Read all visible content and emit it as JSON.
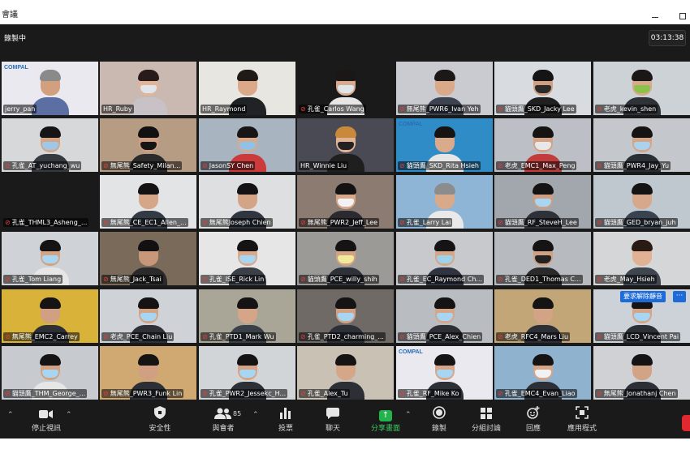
{
  "window": {
    "title": "會議"
  },
  "meeting": {
    "recording_label": "錄製中",
    "timer": "03:13:38"
  },
  "colors": {
    "active_speaker_border": "#c7e33b",
    "muted_mic": "#e0403f",
    "share_green": "#23b24c",
    "unmute_blue": "#1d6bd8"
  },
  "participants": [
    {
      "name": "jerry_pan",
      "muted": false,
      "bg": "#e9e9ef",
      "skin": "#d2a07f",
      "hair": "#8a8a8a",
      "shirt": "#5b6fa3",
      "mask": "",
      "logo": "COMPAL"
    },
    {
      "name": "HR_Ruby",
      "muted": false,
      "bg": "#c9b9b1",
      "skin": "#e2b49a",
      "hair": "#2a1b1b",
      "shirt": "#c8c2c6",
      "mask": "#dfe5ea",
      "active": true
    },
    {
      "name": "HR_Raymond",
      "muted": false,
      "bg": "#e8e6e1",
      "skin": "#dba98a",
      "hair": "#1f1a17",
      "shirt": "#202326",
      "mask": ""
    },
    {
      "name": "孔雀_Carlos Wang",
      "muted": true,
      "bg": "#1a1a1a",
      "skin": "#d8ab8f",
      "hair": "#1b1717",
      "shirt": "#e6e6e6",
      "mask": "#dde4ea"
    },
    {
      "name": "無尾熊_PWR6_Ivan Yeh",
      "muted": true,
      "bg": "#c9cbd0",
      "skin": "#d9a98a",
      "hair": "#1c1818",
      "shirt": "#3d4350",
      "mask": ""
    },
    {
      "name": "貓頭鷹_SKD_Jacky Lee",
      "muted": true,
      "bg": "#d8dbe0",
      "skin": "#cf9f82",
      "hair": "#151313",
      "shirt": "#202020",
      "mask": "#2b2b2b"
    },
    {
      "name": "老虎_kevin_shen",
      "muted": true,
      "bg": "#cdd2d6",
      "skin": "#d8a98b",
      "hair": "#1b1717",
      "shirt": "#2f3338",
      "mask": "#8bc34a"
    },
    {
      "name": "孔雀_AT_yuchang_wu",
      "muted": true,
      "bg": "#d7d8da",
      "skin": "#d5a587",
      "hair": "#161414",
      "shirt": "#353a40",
      "mask": "#9ec7e8"
    },
    {
      "name": "無尾熊_Safety_Milan...",
      "muted": true,
      "bg": "#b59c83",
      "skin": "#cf9d80",
      "hair": "#121010",
      "shirt": "#2b2b2b",
      "mask": "#151515"
    },
    {
      "name": "JasonSY Chen",
      "muted": true,
      "bg": "#a8b5c0",
      "skin": "#d8a98b",
      "hair": "#171515",
      "shirt": "#cc3b3b",
      "mask": "#8fc2e6"
    },
    {
      "name": "HR_Winnie Liu",
      "muted": false,
      "bg": "#4a4a55",
      "skin": "#e1b394",
      "hair": "#c88a3a",
      "shirt": "#1f1f1f",
      "mask": "#222222"
    },
    {
      "name": "貓頭鷹_SKD_Rita Hsieh",
      "muted": true,
      "bg": "#2f8cc6",
      "skin": "#d9aa8c",
      "hair": "#171414",
      "shirt": "#e6e6e6",
      "mask": "",
      "logo": "COMPAL"
    },
    {
      "name": "老虎_EMC1_Max_Peng",
      "muted": true,
      "bg": "#bcbfc5",
      "skin": "#d4a385",
      "hair": "#161313",
      "shirt": "#c23c3c",
      "mask": "#e8e8ea"
    },
    {
      "name": "貓頭鷹_PWR4_Jay_Yu",
      "muted": true,
      "bg": "#c4c7cc",
      "skin": "#d5a586",
      "hair": "#161313",
      "shirt": "#2a2f36",
      "mask": "#a9d2ef"
    },
    {
      "name": "孔雀_THML3_Asheng_...",
      "muted": true,
      "bg": "#1a1a1a",
      "skin": "",
      "hair": "",
      "shirt": "",
      "mask": "",
      "empty": true
    },
    {
      "name": "無尾熊_CE_EC1_Allen_...",
      "muted": true,
      "bg": "#e2e4e6",
      "skin": "#d6a688",
      "hair": "#141212",
      "shirt": "#343a44",
      "mask": ""
    },
    {
      "name": "無尾熊Joseph Chien",
      "muted": true,
      "bg": "#dedfe1",
      "skin": "#d4a486",
      "hair": "#141212",
      "shirt": "#303540",
      "mask": ""
    },
    {
      "name": "無尾熊_PWR2_Jeff_Lee",
      "muted": true,
      "bg": "#8b7b71",
      "skin": "#d7a789",
      "hair": "#141212",
      "shirt": "#2a2a30",
      "mask": "#f2f2f4"
    },
    {
      "name": "孔雀_Larry Lai",
      "muted": true,
      "bg": "#8fb5d6",
      "skin": "#d8a98b",
      "hair": "#8c8c8c",
      "shirt": "#e9e9e9",
      "mask": ""
    },
    {
      "name": "貓頭鷹_RF_SteveH_Lee",
      "muted": true,
      "bg": "#a2a7ad",
      "skin": "#cf9e80",
      "hair": "#151313",
      "shirt": "#2e3238",
      "mask": "#a7d5f2"
    },
    {
      "name": "貓頭鷹_GED_bryan_juh",
      "muted": true,
      "bg": "#bfc7cf",
      "skin": "#d7a88a",
      "hair": "#151313",
      "shirt": "#394350",
      "mask": ""
    },
    {
      "name": "孔雀_Tom Liang",
      "muted": true,
      "bg": "#cfd3d7",
      "skin": "#d3a385",
      "hair": "#151313",
      "shirt": "#e6e6e6",
      "mask": "#a7d5f2"
    },
    {
      "name": "無尾熊_Jack_Tsai",
      "muted": true,
      "bg": "#7a6a5a",
      "skin": "#c8977a",
      "hair": "#121010",
      "shirt": "#2a2a2a",
      "mask": ""
    },
    {
      "name": "孔雀_ISE_Rick Lin",
      "muted": true,
      "bg": "#e6e6e6",
      "skin": "#d8a98b",
      "hair": "#151313",
      "shirt": "#3a3f48",
      "mask": "#a7d5f2"
    },
    {
      "name": "貓頭鷹_PCE_willy_shih",
      "muted": true,
      "bg": "#9c9a96",
      "skin": "#d3a385",
      "hair": "#151313",
      "shirt": "#2e3238",
      "mask": "#f2ea9a"
    },
    {
      "name": "孔雀_EC_Raymond Ch...",
      "muted": true,
      "bg": "#c7c9cd",
      "skin": "#d6a688",
      "hair": "#151313",
      "shirt": "#2f3440",
      "mask": "#9ed2ea"
    },
    {
      "name": "孔雀_DED1_Thomas C...",
      "muted": true,
      "bg": "#b7bbbf",
      "skin": "#d0a082",
      "hair": "#151313",
      "shirt": "#2a2a2a",
      "mask": "#222222"
    },
    {
      "name": "老虎_May_Hsieh",
      "muted": true,
      "bg": "#d4d6d8",
      "skin": "#e0b293",
      "hair": "#2a1a14",
      "shirt": "#3f4650",
      "mask": ""
    },
    {
      "name": "無尾熊_EMC2_Carrey",
      "muted": true,
      "bg": "#d9b23a",
      "skin": "#d1a083",
      "hair": "#151313",
      "shirt": "#2c3036",
      "mask": ""
    },
    {
      "name": "老虎_PCE_Chain Liu",
      "muted": true,
      "bg": "#cfd2d6",
      "skin": "#d4a486",
      "hair": "#151313",
      "shirt": "#2e3238",
      "mask": "#a7d5f2"
    },
    {
      "name": "孔雀_PTD1_Mark Wu",
      "muted": true,
      "bg": "#a9a597",
      "skin": "#d5a587",
      "hair": "#151313",
      "shirt": "#3a4048",
      "mask": ""
    },
    {
      "name": "孔雀_PTD2_charming_...",
      "muted": true,
      "bg": "#6f6a66",
      "skin": "#d2a284",
      "hair": "#151313",
      "shirt": "#2c3036",
      "mask": "#a7d5f2"
    },
    {
      "name": "貓頭鷹_PCE_Alex_Chien",
      "muted": true,
      "bg": "#b9bcc0",
      "skin": "#d6a688",
      "hair": "#151313",
      "shirt": "#2c3036",
      "mask": "#a7d5f2"
    },
    {
      "name": "老虎_RFC4_Mars Liu",
      "muted": true,
      "bg": "#c2a678",
      "skin": "#d3a385",
      "hair": "#151313",
      "shirt": "#2c3036",
      "mask": ""
    },
    {
      "name": "貓頭鷹_LCD_Vincent Pai",
      "muted": true,
      "bg": "#cdd2d8",
      "skin": "#d5a587",
      "hair": "#151313",
      "shirt": "#2c3036",
      "mask": "#a7d5f2"
    },
    {
      "name": "貓頭鷹_THM_George_...",
      "muted": true,
      "bg": "#c7cbd0",
      "skin": "#d2a284",
      "hair": "#151313",
      "shirt": "#e6e6e6",
      "mask": "#a7d5f2"
    },
    {
      "name": "無尾熊_PWR3_Funk Lin",
      "muted": true,
      "bg": "#d0a872",
      "skin": "#d1a083",
      "hair": "#151313",
      "shirt": "#2c3036",
      "mask": ""
    },
    {
      "name": "孔雀_PWR2_Jessekc_H...",
      "muted": true,
      "bg": "#d2d5d8",
      "skin": "#d4a486",
      "hair": "#151313",
      "shirt": "#2c3036",
      "mask": "#a7d5f2"
    },
    {
      "name": "孔雀_Alex_Tu",
      "muted": true,
      "bg": "#c9c2b4",
      "skin": "#d6a688",
      "hair": "#151313",
      "shirt": "#2c3036",
      "mask": ""
    },
    {
      "name": "孔雀_RF_Mike Ko",
      "muted": true,
      "bg": "#e9e9ef",
      "skin": "#d6a688",
      "hair": "#151313",
      "shirt": "#2c3036",
      "mask": "#a7d5f2",
      "logo": "COMPAL"
    },
    {
      "name": "孔雀_EMC4_Evan_Liao",
      "muted": true,
      "bg": "#8fb2cf",
      "skin": "#d5a587",
      "hair": "#151313",
      "shirt": "#2c3036",
      "mask": "#f2f2f4"
    },
    {
      "name": "無尾熊_Jonathanj Chen",
      "muted": true,
      "bg": "#cfd1d4",
      "skin": "#d3a385",
      "hair": "#151313",
      "shirt": "#2c3036",
      "mask": ""
    }
  ],
  "overlay": {
    "unmute_request": "要求解除靜音",
    "more": "···"
  },
  "toolbar": {
    "items": [
      {
        "label": "停止視訊",
        "icon": "video-camera-icon"
      },
      {
        "label": "安全性",
        "icon": "shield-icon"
      },
      {
        "label": "與會者",
        "icon": "participants-icon",
        "count": "85"
      },
      {
        "label": "投票",
        "icon": "poll-icon"
      },
      {
        "label": "聊天",
        "icon": "chat-icon"
      },
      {
        "label": "分享畫面",
        "icon": "share-screen-icon"
      },
      {
        "label": "錄製",
        "icon": "record-icon"
      },
      {
        "label": "分組討論",
        "icon": "breakout-rooms-icon"
      },
      {
        "label": "回應",
        "icon": "reactions-icon"
      },
      {
        "label": "應用程式",
        "icon": "apps-icon"
      }
    ]
  }
}
